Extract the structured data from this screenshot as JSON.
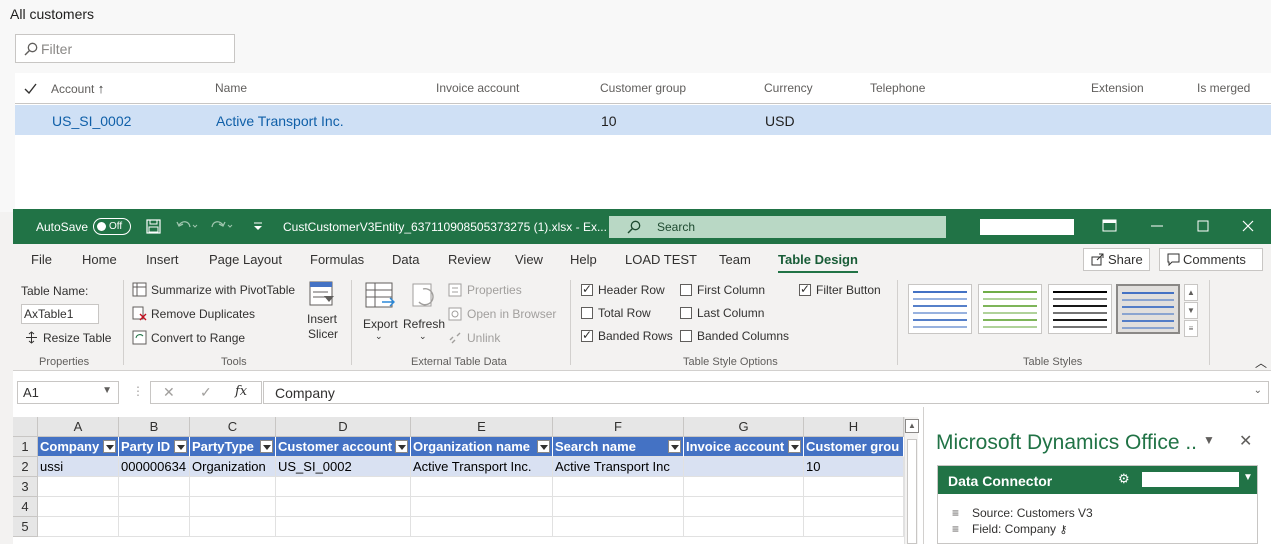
{
  "page": {
    "title": "All customers"
  },
  "filter": {
    "placeholder": "Filter"
  },
  "grid": {
    "columns": [
      "Account",
      "Name",
      "Invoice account",
      "Customer group",
      "Currency",
      "Telephone",
      "Extension",
      "Is merged"
    ],
    "sort_arrow": "↑",
    "rows": [
      {
        "account": "US_SI_0002",
        "name": "Active Transport Inc.",
        "invoice_account": "",
        "customer_group": "10",
        "currency": "USD",
        "telephone": "",
        "extension": "",
        "is_merged": ""
      }
    ]
  },
  "excel": {
    "autosave_label": "AutoSave",
    "autosave_state": "Off",
    "file_title": "CustCustomerV3Entity_637110908505373275 (1).xlsx  -  Ex...",
    "search_label": "Search",
    "tabs": [
      "File",
      "Home",
      "Insert",
      "Page Layout",
      "Formulas",
      "Data",
      "Review",
      "View",
      "Help",
      "LOAD TEST",
      "Team",
      "Table Design"
    ],
    "active_tab": "Table Design",
    "share_label": "Share",
    "comments_label": "Comments",
    "ribbon": {
      "properties": {
        "table_name_label": "Table Name:",
        "table_name_value": "AxTable1",
        "resize_label": "Resize Table",
        "group_label": "Properties"
      },
      "tools": {
        "summarize": "Summarize with PivotTable",
        "remove_dup": "Remove Duplicates",
        "convert": "Convert to Range",
        "insert_slicer_1": "Insert",
        "insert_slicer_2": "Slicer",
        "group_label": "Tools"
      },
      "external": {
        "export": "Export",
        "refresh": "Refresh",
        "properties": "Properties",
        "open_browser": "Open in Browser",
        "unlink": "Unlink",
        "group_label": "External Table Data"
      },
      "style_options": {
        "header_row": "Header Row",
        "total_row": "Total Row",
        "banded_rows": "Banded Rows",
        "first_column": "First Column",
        "last_column": "Last Column",
        "banded_columns": "Banded Columns",
        "filter_button": "Filter Button",
        "group_label": "Table Style Options",
        "checked": {
          "header_row": true,
          "total_row": false,
          "banded_rows": true,
          "first_column": false,
          "last_column": false,
          "banded_columns": false,
          "filter_button": true
        }
      },
      "table_styles": {
        "group_label": "Table Styles",
        "colors": [
          "#4472c4",
          "#70ad47",
          "#000000",
          "#4472c4"
        ]
      }
    },
    "formula_bar": {
      "name_box": "A1",
      "fx": "fx",
      "cancel": "✕",
      "enter": "✓",
      "content": "Company"
    },
    "sheet": {
      "columns": [
        "A",
        "B",
        "C",
        "D",
        "E",
        "F",
        "G",
        "H"
      ],
      "rows": [
        "1",
        "2",
        "3",
        "4",
        "5"
      ],
      "headers": [
        "Company",
        "Party ID",
        "PartyType",
        "Customer account",
        "Organization name",
        "Search name",
        "Invoice account",
        "Customer grou"
      ],
      "data": [
        [
          "ussi",
          "000000634",
          "Organization",
          "US_SI_0002",
          "Active Transport Inc.",
          "Active Transport Inc",
          "",
          "10"
        ]
      ]
    },
    "pane": {
      "title": "Microsoft Dynamics Office ..",
      "connector_title": "Data Connector",
      "source": "Source: Customers V3",
      "field": "Field: Company"
    }
  }
}
